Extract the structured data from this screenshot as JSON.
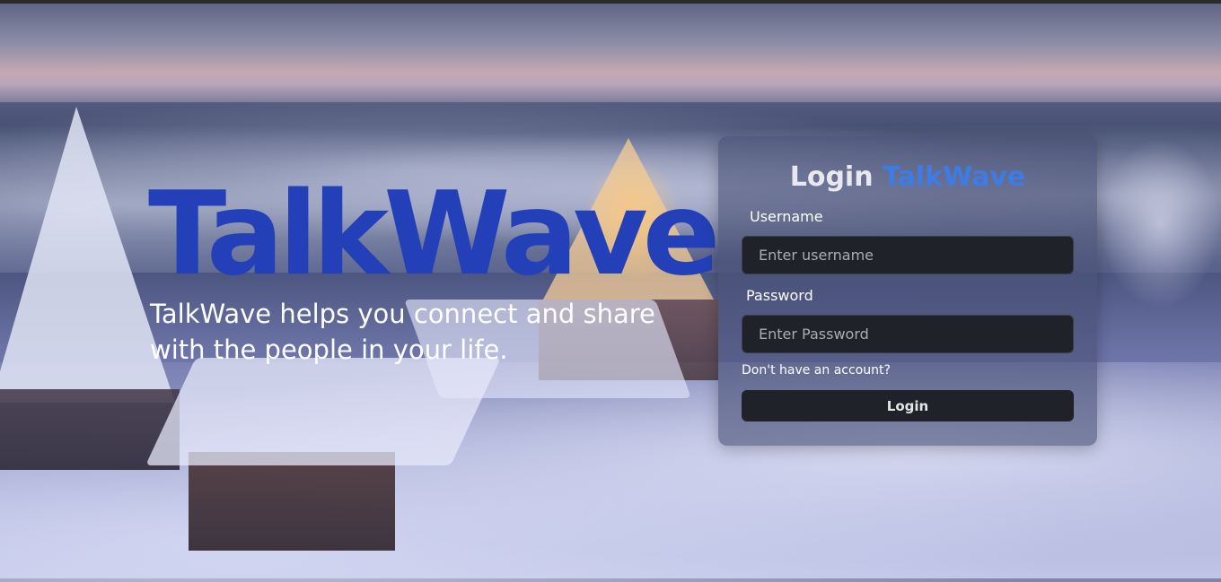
{
  "hero": {
    "title": "TalkWave",
    "subtitle": "TalkWave helps you connect and share with the people in your life."
  },
  "login": {
    "title_prefix": "Login",
    "title_brand": "TalkWave",
    "username_label": "Username",
    "username_placeholder": "Enter username",
    "password_label": "Password",
    "password_placeholder": "Enter Password",
    "signup_link": "Don't have an account?",
    "submit_label": "Login"
  },
  "colors": {
    "hero_title": "#2340b8",
    "brand_accent": "#3d7be5",
    "input_bg": "#1f2329",
    "button_bg": "#1f2329"
  }
}
